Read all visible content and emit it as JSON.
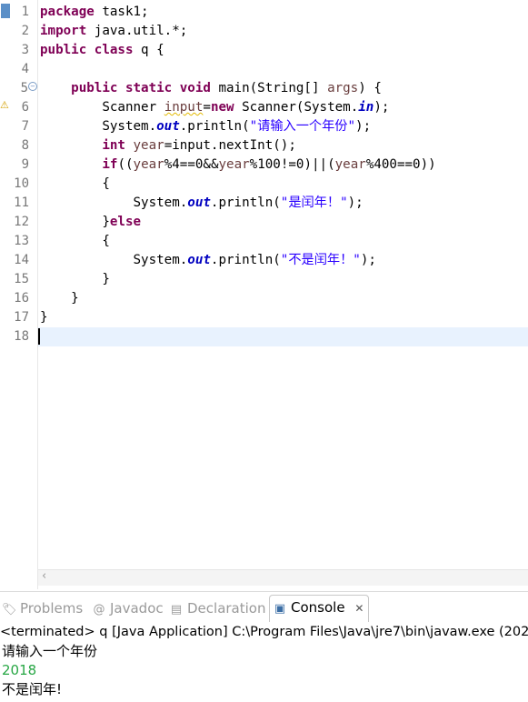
{
  "editor": {
    "line_numbers": [
      "1",
      "2",
      "3",
      "4",
      "5",
      "6",
      "7",
      "8",
      "9",
      "10",
      "11",
      "12",
      "13",
      "14",
      "15",
      "16",
      "17",
      "18"
    ],
    "lines": {
      "l1": {
        "kw": "package",
        "rest": " task1;"
      },
      "l2": {
        "kw": "import",
        "rest": " java.util.*;"
      },
      "l3": {
        "kw1": "public",
        "kw2": "class",
        "rest": " q {"
      },
      "l5": {
        "indent": "    ",
        "kw1": "public",
        "kw2": "static",
        "kw3": "void",
        "mid": " main(String[] ",
        "param": "args",
        "rest": ") {"
      },
      "l6": {
        "indent": "        ",
        "t1": "Scanner ",
        "var": "input",
        "eq": "=",
        "kw": "new",
        "t2": " Scanner(System.",
        "fld": "in",
        "rest": ");"
      },
      "l7": {
        "indent": "        ",
        "t1": "System.",
        "fld": "out",
        "t2": ".println(",
        "str": "\"请输入一个年份\"",
        "rest": ");"
      },
      "l8": {
        "indent": "        ",
        "kw": "int",
        "sp": " ",
        "var": "year",
        "rest": "=input.nextInt();"
      },
      "l9": {
        "indent": "        ",
        "kw": "if",
        "p1": "((",
        "v1": "year",
        "p2": "%4==0&&",
        "v2": "year",
        "p3": "%100!=0)||(",
        "v3": "year",
        "p4": "%400==0))"
      },
      "l10": {
        "indent": "        ",
        "text": "{"
      },
      "l11": {
        "indent": "            ",
        "t1": "System.",
        "fld": "out",
        "t2": ".println(",
        "str": "\"是闰年！\"",
        "rest": ");"
      },
      "l12": {
        "indent": "        ",
        "brace": "}",
        "kw": "else"
      },
      "l13": {
        "indent": "        ",
        "text": "{"
      },
      "l14": {
        "indent": "            ",
        "t1": "System.",
        "fld": "out",
        "t2": ".println(",
        "str": "\"不是闰年！\"",
        "rest": ");"
      },
      "l15": {
        "indent": "        ",
        "text": "}"
      },
      "l16": {
        "indent": "    ",
        "text": "}"
      },
      "l17": {
        "text": "}"
      }
    }
  },
  "tabs": {
    "problems": "Problems",
    "javadoc": "Javadoc",
    "declaration": "Declaration",
    "console": "Console"
  },
  "console": {
    "header": "<terminated> q [Java Application] C:\\Program Files\\Java\\jre7\\bin\\javaw.exe (202",
    "output": [
      {
        "text": "请输入一个年份",
        "color": "#000000"
      },
      {
        "text": "2018",
        "color": "#28a745"
      },
      {
        "text": "不是闰年!",
        "color": "#000000"
      }
    ]
  },
  "colors": {
    "keyword": "#7f0055",
    "string": "#2a00ff",
    "field": "#0000c0",
    "variable": "#6a3e3e",
    "current_line": "#e8f2fe",
    "console_input": "#28a745"
  }
}
